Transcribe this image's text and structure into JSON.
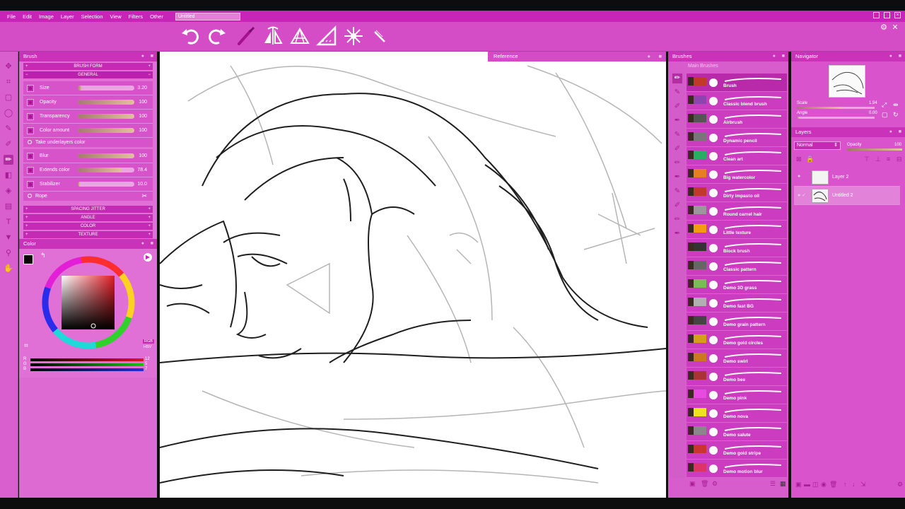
{
  "menubar": {
    "items": [
      "File",
      "Edit",
      "Image",
      "Layer",
      "Selection",
      "View",
      "Filters",
      "Other"
    ],
    "document_tab": "Untitled"
  },
  "brush_panel": {
    "title": "Brush",
    "section_brush_form": "BRUSH FORM",
    "section_general": "GENERAL",
    "props": [
      {
        "label": "Size",
        "value": "3.20",
        "fraction": 0.08
      },
      {
        "label": "Opacity",
        "value": "100",
        "fraction": 1.0
      },
      {
        "label": "Transparency",
        "value": "100",
        "fraction": 1.0
      },
      {
        "label": "Color amount",
        "value": "100",
        "fraction": 1.0
      }
    ],
    "take_underlayers": "Take underlayers color",
    "props2": [
      {
        "label": "Blur",
        "value": "100",
        "fraction": 1.0
      },
      {
        "label": "Extends color",
        "value": "78.4",
        "fraction": 0.78
      },
      {
        "label": "Stabilizer",
        "value": "10.0",
        "fraction": 0.04
      }
    ],
    "rope": "Rope",
    "sections_bottom": [
      "SPACING JITTER",
      "ANGLE",
      "COLOR",
      "TEXTURE"
    ]
  },
  "color_panel": {
    "title": "Color",
    "mode_label": "RGB",
    "mode_sub": "HSV",
    "channels": [
      {
        "label": "R",
        "value": "12",
        "color": "#e0102a"
      },
      {
        "label": "G",
        "value": "5",
        "color": "#17c214"
      },
      {
        "label": "B",
        "value": "7",
        "color": "#2a2ad8"
      }
    ]
  },
  "reference": {
    "title": "Reference"
  },
  "brushes_panel": {
    "title": "Brushes",
    "group": "Main Brushes",
    "items": [
      "Brush",
      "Classic blend brush",
      "Airbrush",
      "Dynamic pencil",
      "Clean art",
      "Big watercolor",
      "Dirty impasto oil",
      "Round camel hair",
      "Little texture",
      "Block brush",
      "Classic pattern",
      "Demo 3D grass",
      "Demo fast BG",
      "Demo grain pattern",
      "Demo gold circles",
      "Demo swirl",
      "Demo bee",
      "Demo pink",
      "Demo nova",
      "Demo salute",
      "Demo gold stripe",
      "Demo motion blur"
    ]
  },
  "navigator": {
    "title": "Navigator",
    "scale_label": "Scale",
    "scale_value": "1.94",
    "angle_label": "Angle",
    "angle_value": "0.00"
  },
  "layers": {
    "title": "Layers",
    "blend_mode": "Normal",
    "opacity_label": "Opacity",
    "opacity_value": "100",
    "items": [
      "Layer 2",
      "Untitled 2"
    ]
  },
  "colors": {
    "accent": "#c724b8",
    "panel": "#e06fd6",
    "toolbar": "#d44cc6"
  }
}
